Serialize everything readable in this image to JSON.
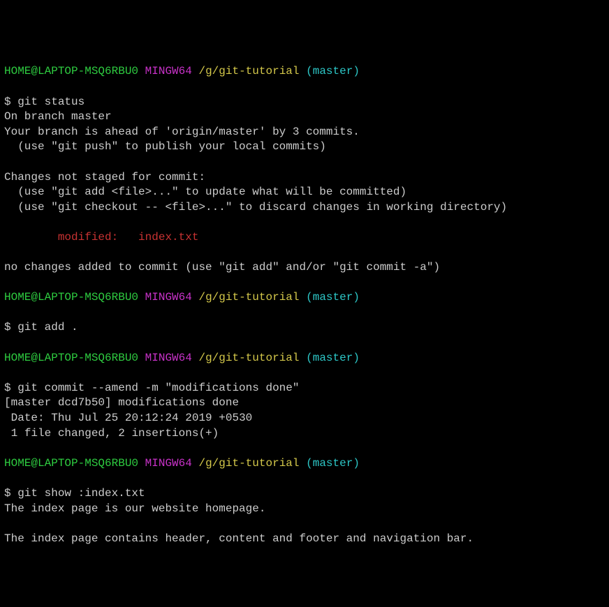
{
  "prompt": {
    "user_host": "HOME@LAPTOP-MSQ6RBU0",
    "env": "MINGW64",
    "cwd": "/g/git-tutorial",
    "branch": "(master)"
  },
  "block1": {
    "cmd": "$ git status",
    "l1": "On branch master",
    "l2": "Your branch is ahead of 'origin/master' by 3 commits.",
    "l3": "  (use \"git push\" to publish your local commits)",
    "l4": "Changes not staged for commit:",
    "l5": "  (use \"git add <file>...\" to update what will be committed)",
    "l6": "  (use \"git checkout -- <file>...\" to discard changes in working directory)",
    "l7": "        modified:   index.txt",
    "l8": "no changes added to commit (use \"git add\" and/or \"git commit -a\")"
  },
  "block2": {
    "cmd": "$ git add ."
  },
  "block3": {
    "cmd": "$ git commit --amend -m \"modifications done\"",
    "l1": "[master dcd7b50] modifications done",
    "l2": " Date: Thu Jul 25 20:12:24 2019 +0530",
    "l3": " 1 file changed, 2 insertions(+)"
  },
  "block4": {
    "cmd": "$ git show :index.txt",
    "l1": "The index page is our website homepage.",
    "l2": "The index page contains header, content and footer and navigation bar."
  }
}
